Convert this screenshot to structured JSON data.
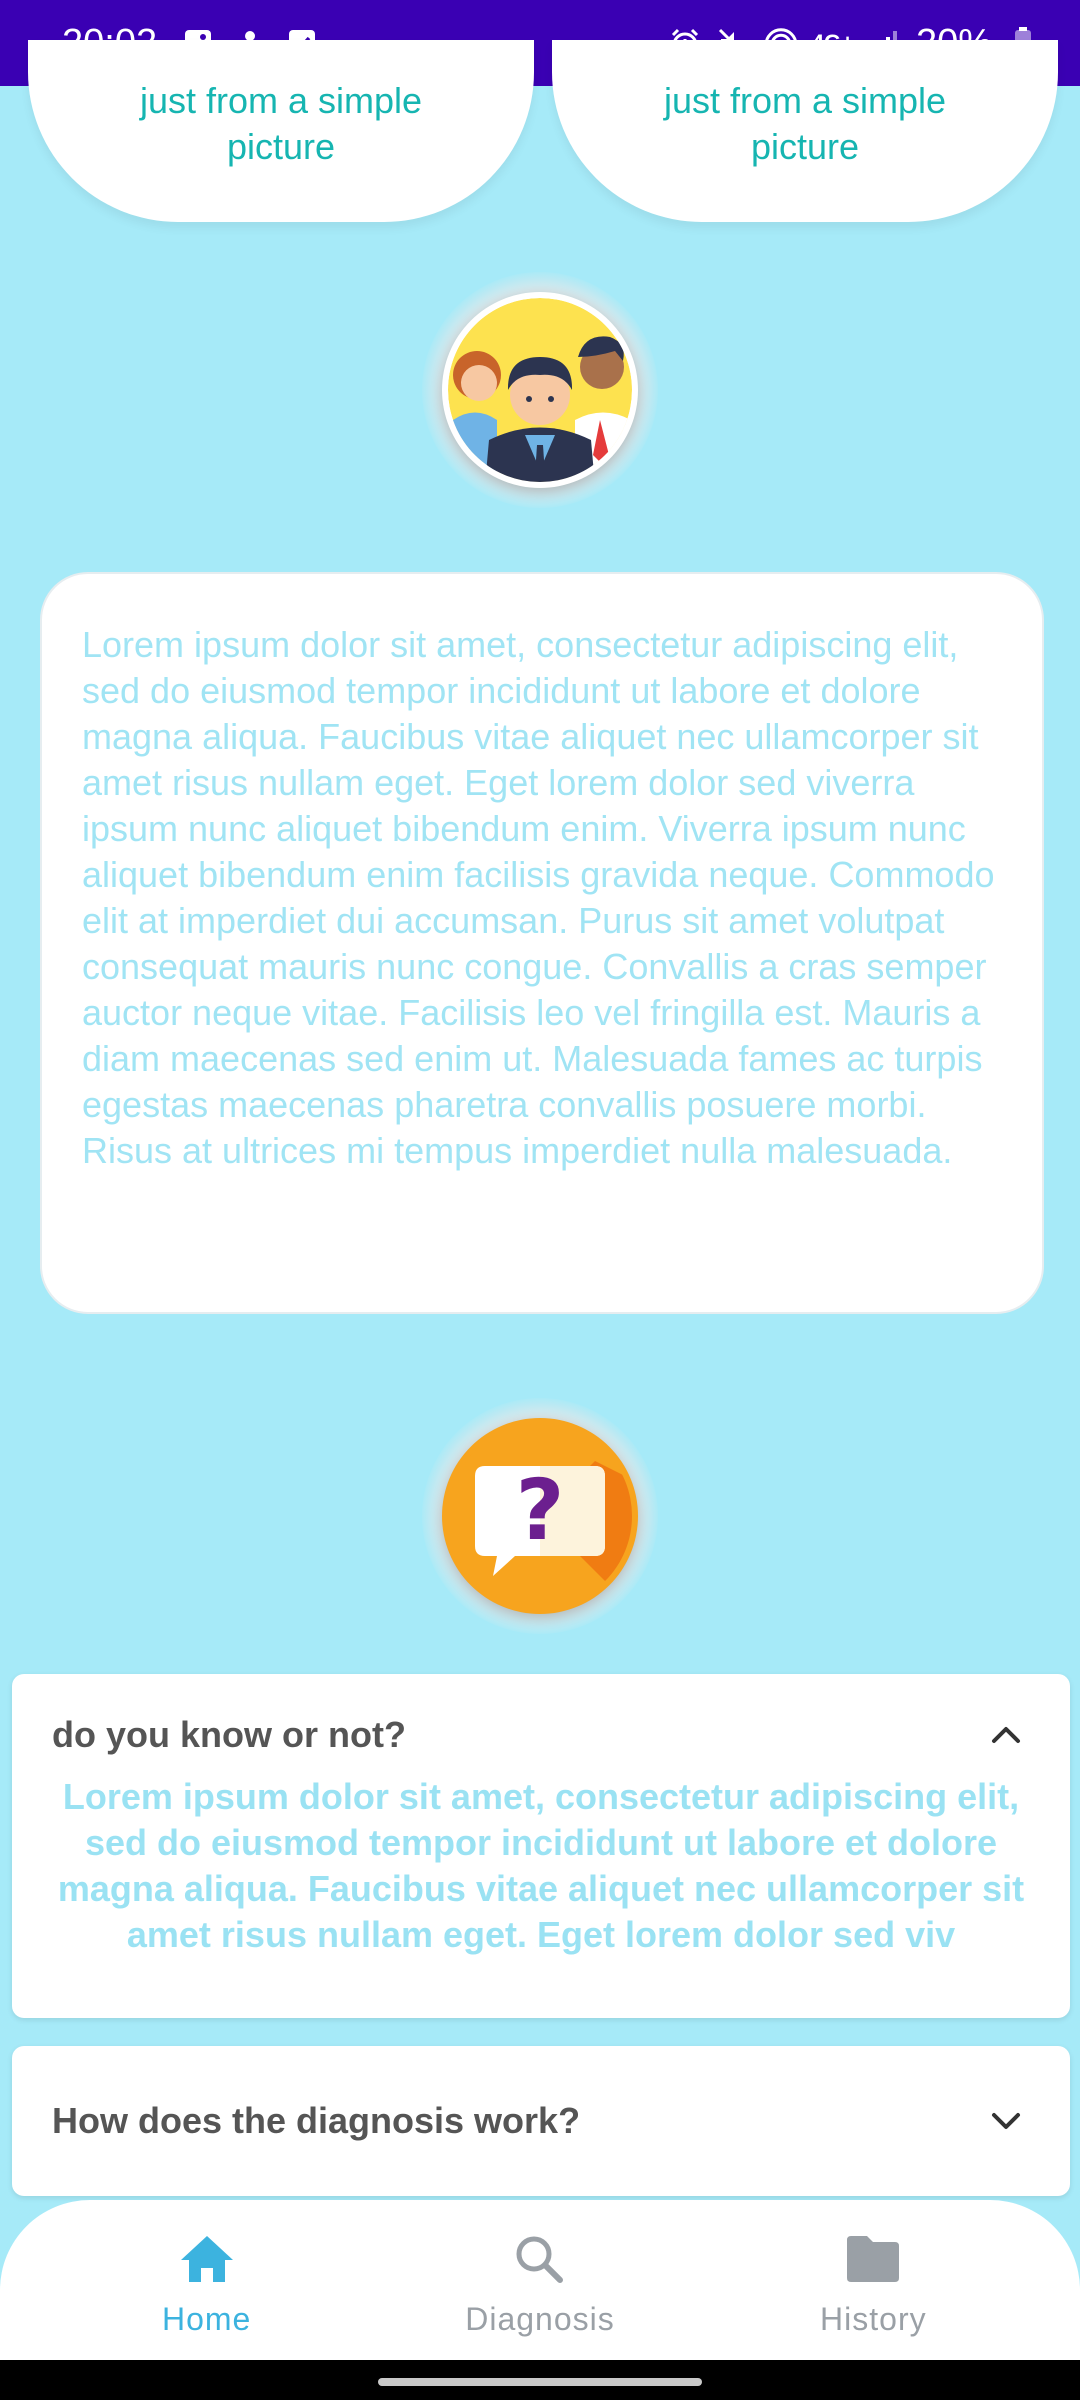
{
  "status_bar": {
    "time": "20:02",
    "network": "4G+",
    "battery": "20%"
  },
  "top_cards": [
    {
      "text_line1": "just from a simple",
      "text_line2": "picture"
    },
    {
      "text_line1": "just from a simple",
      "text_line2": "picture"
    }
  ],
  "about": {
    "paragraph": "Lorem ipsum dolor sit amet, consectetur adipiscing elit, sed do eiusmod tempor incididunt ut labore et dolore magna aliqua. Faucibus vitae aliquet nec ullamcorper sit amet risus nullam eget. Eget lorem dolor sed viverra ipsum nunc aliquet bibendum enim. Viverra ipsum nunc aliquet bibendum enim facilisis gravida neque. Commodo elit at imperdiet dui accumsan. Purus sit amet volutpat consequat mauris nunc congue. Convallis a cras semper auctor neque vitae. Facilisis leo vel fringilla est. Mauris a diam maecenas sed enim ut. Malesuada fames ac turpis egestas maecenas pharetra convallis posuere morbi. Risus at ultrices mi tempus imperdiet nulla malesuada."
  },
  "faq": [
    {
      "question": "do you know or not?",
      "answer": "Lorem ipsum dolor sit amet, consectetur adipiscing elit, sed do eiusmod tempor incididunt ut labore et dolore magna aliqua. Faucibus vitae aliquet nec ullamcorper sit amet risus nullam eget. Eget lorem dolor sed viv",
      "expanded": true
    },
    {
      "question": "How does the diagnosis work?",
      "expanded": false
    }
  ],
  "nav": {
    "items": [
      {
        "label": "Home",
        "icon": "home-icon",
        "active": true
      },
      {
        "label": "Diagnosis",
        "icon": "search-icon",
        "active": false
      },
      {
        "label": "History",
        "icon": "folder-icon",
        "active": false
      }
    ]
  },
  "colors": {
    "background": "#a6eaf8",
    "status_bar": "#3a00b3",
    "accent": "#3cb3df",
    "teal_text": "#16b5b1",
    "light_text": "#a0e4f4"
  }
}
